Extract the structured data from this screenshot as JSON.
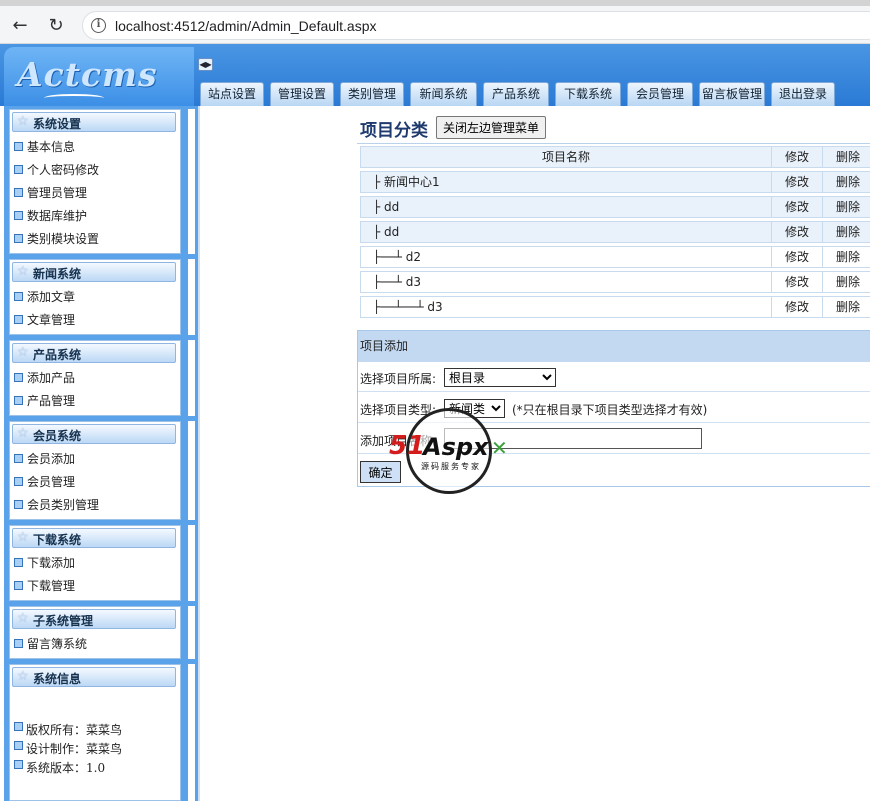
{
  "browser": {
    "url": "localhost:4512/admin/Admin_Default.aspx"
  },
  "header": {
    "logo": "Actcms",
    "tabs": [
      "站点设置",
      "管理设置",
      "类别管理",
      "新闻系统",
      "产品系统",
      "下载系统",
      "会员管理",
      "留言板管理",
      "退出登录"
    ]
  },
  "sidebar": {
    "panels": [
      {
        "title": "系统设置",
        "items": [
          "基本信息",
          "个人密码修改",
          "管理员管理",
          "数据库维护",
          "类别模块设置"
        ]
      },
      {
        "title": "新闻系统",
        "items": [
          "添加文章",
          "文章管理"
        ]
      },
      {
        "title": "产品系统",
        "items": [
          "添加产品",
          "产品管理"
        ]
      },
      {
        "title": "会员系统",
        "items": [
          "会员添加",
          "会员管理",
          "会员类别管理"
        ]
      },
      {
        "title": "下载系统",
        "items": [
          "下载添加",
          "下载管理"
        ]
      },
      {
        "title": "子系统管理",
        "items": [
          "留言簿系统"
        ]
      },
      {
        "title": "系统信息",
        "items": [
          "版权所有：菜菜鸟",
          "设计制作：菜菜鸟",
          "系统版本：1.0"
        ]
      }
    ]
  },
  "main": {
    "title": "项目分类",
    "close_button": "关闭左边管理菜单",
    "table": {
      "headers": [
        "项目名称",
        "修改",
        "删除"
      ],
      "rows": [
        {
          "name": "├ 新闻中心1",
          "edit": "修改",
          "del": "删除"
        },
        {
          "name": "├ dd",
          "edit": "修改",
          "del": "删除"
        },
        {
          "name": "├ dd",
          "edit": "修改",
          "del": "删除"
        },
        {
          "name": "├──┴ d2",
          "edit": "修改",
          "del": "删除"
        },
        {
          "name": "├──┴ d3",
          "edit": "修改",
          "del": "删除"
        },
        {
          "name": "├──┴──┴ d3",
          "edit": "修改",
          "del": "删除"
        }
      ]
    },
    "add": {
      "heading": "项目添加",
      "parent_label": "选择项目所属:",
      "parent_value": "根目录",
      "type_label": "选择项目类型:",
      "type_value": "新闻类",
      "type_hint": "(*只在根目录下项目类型选择才有效)",
      "name_label": "添加项目名称:",
      "name_value": "",
      "submit": "确定"
    }
  },
  "watermark": {
    "brand_a": "51",
    "brand_b": "Aspx",
    "tagline": "源码服务专家"
  }
}
